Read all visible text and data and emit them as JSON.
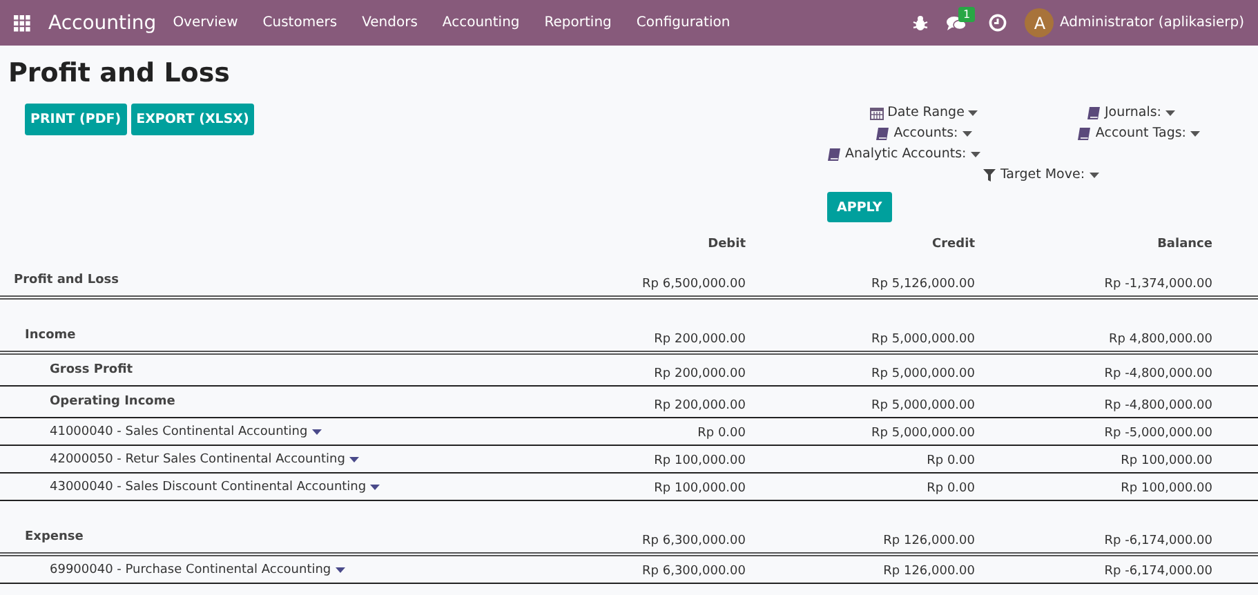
{
  "navbar": {
    "app_name": "Accounting",
    "menu": [
      "Overview",
      "Customers",
      "Vendors",
      "Accounting",
      "Reporting",
      "Configuration"
    ],
    "messages_count": "1",
    "user": {
      "initial": "A",
      "name": "Administrator (aplikasierp)"
    }
  },
  "page_title": "Profit and Loss",
  "actions": [
    "PRINT (PDF)",
    "EXPORT (XLSX)"
  ],
  "filters": [
    {
      "label": "Date Range",
      "kind": "date"
    },
    {
      "label": "Journals:",
      "kind": "book"
    },
    {
      "label": "Accounts:",
      "kind": "book"
    },
    {
      "label": "Account Tags:",
      "kind": "book"
    },
    {
      "label": "Analytic Accounts:",
      "kind": "book"
    },
    {
      "label": "Target Move:",
      "kind": "filter"
    }
  ],
  "apply_button": "APPLY",
  "table": {
    "columns": [
      "Debit",
      "Credit",
      "Balance"
    ],
    "rows": [
      {
        "kind": "total",
        "name": "Profit and Loss",
        "debit": "Rp 6,500,000.00",
        "credit": "Rp 5,126,000.00",
        "balance": "Rp -1,374,000.00"
      },
      {
        "kind": "section",
        "name": "Income",
        "debit": "Rp 200,000.00",
        "credit": "Rp 5,000,000.00",
        "balance": "Rp 4,800,000.00"
      },
      {
        "kind": "group",
        "name": "Gross Profit",
        "debit": "Rp 200,000.00",
        "credit": "Rp 5,000,000.00",
        "balance": "Rp -4,800,000.00"
      },
      {
        "kind": "group",
        "name": "Operating Income",
        "debit": "Rp 200,000.00",
        "credit": "Rp 5,000,000.00",
        "balance": "Rp -4,800,000.00"
      },
      {
        "kind": "account",
        "name": "41000040 - Sales Continental Accounting",
        "debit": "Rp 0.00",
        "credit": "Rp 5,000,000.00",
        "balance": "Rp -5,000,000.00"
      },
      {
        "kind": "account",
        "name": "42000050 - Retur Sales Continental Accounting",
        "debit": "Rp 100,000.00",
        "credit": "Rp 0.00",
        "balance": "Rp 100,000.00"
      },
      {
        "kind": "account",
        "name": "43000040 - Sales Discount Continental Accounting",
        "debit": "Rp 100,000.00",
        "credit": "Rp 0.00",
        "balance": "Rp 100,000.00"
      },
      {
        "kind": "section",
        "name": "Expense",
        "debit": "Rp 6,300,000.00",
        "credit": "Rp 126,000.00",
        "balance": "Rp -6,174,000.00"
      },
      {
        "kind": "account",
        "name": "69900040 - Purchase Continental Accounting",
        "debit": "Rp 6,300,000.00",
        "credit": "Rp 126,000.00",
        "balance": "Rp -6,174,000.00"
      }
    ]
  }
}
